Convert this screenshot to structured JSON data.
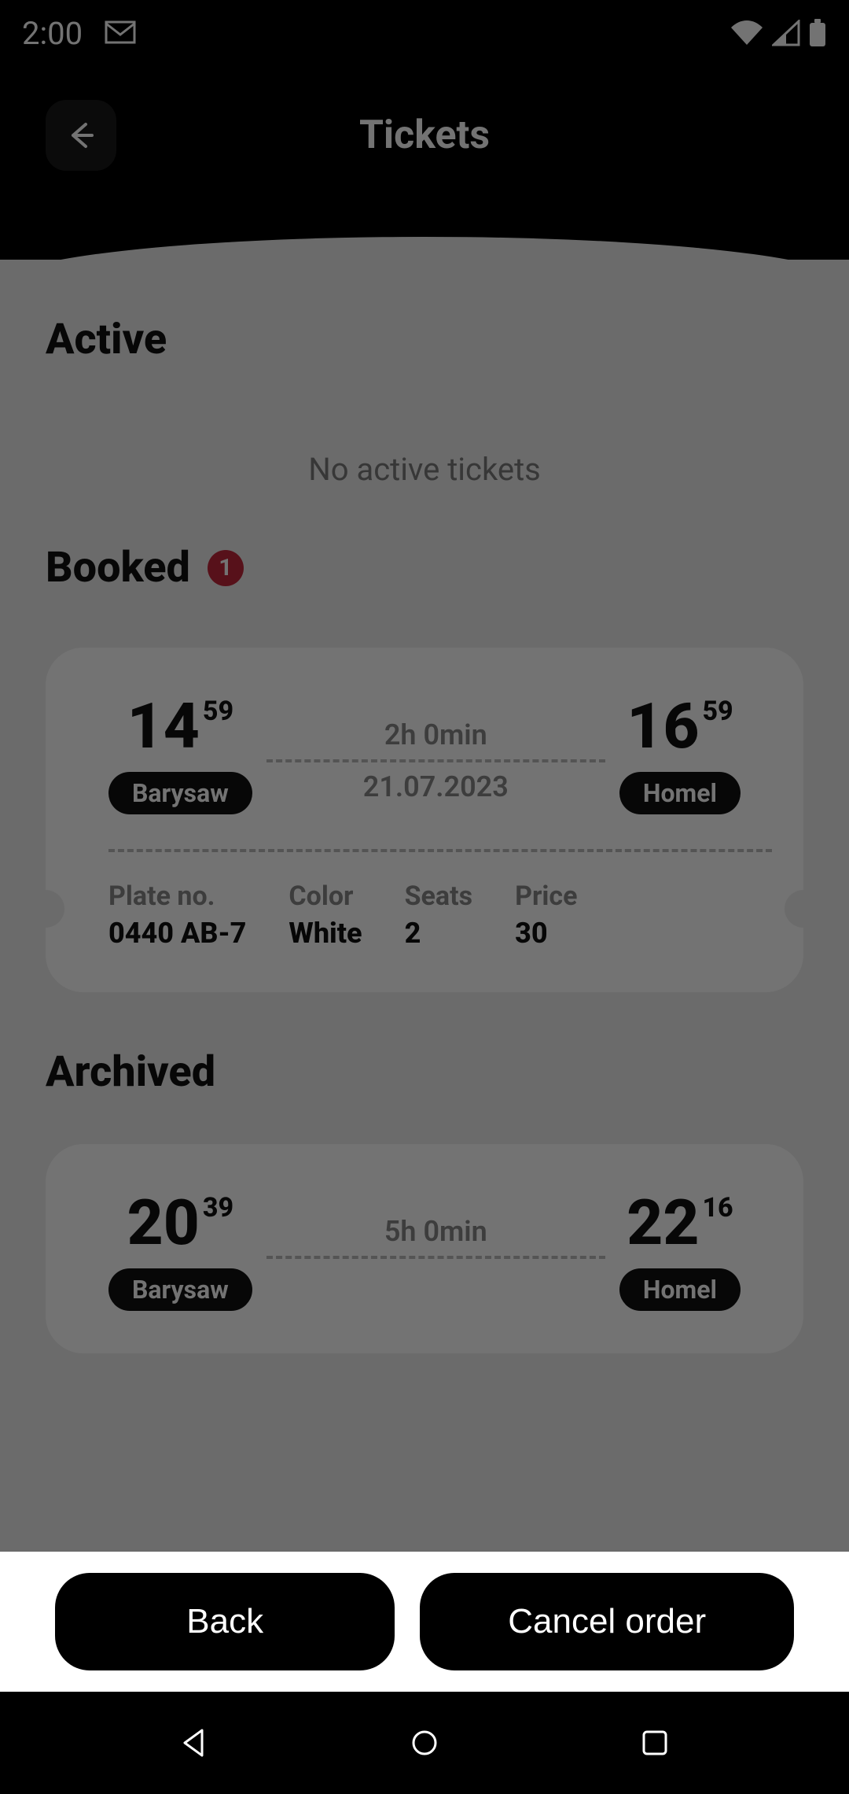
{
  "status": {
    "time": "2:00"
  },
  "header": {
    "title": "Tickets"
  },
  "sections": {
    "active": {
      "title": "Active",
      "empty_text": "No active tickets"
    },
    "booked": {
      "title": "Booked",
      "badge": "1"
    },
    "archived": {
      "title": "Archived"
    }
  },
  "booked_ticket": {
    "dep_h": "14",
    "dep_m": "59",
    "dep_city": "Barysaw",
    "arr_h": "16",
    "arr_m": "59",
    "arr_city": "Homel",
    "duration": "2h 0min",
    "date": "21.07.2023",
    "labels": {
      "plate": "Plate no.",
      "color": "Color",
      "seats": "Seats",
      "price": "Price"
    },
    "plate": "0440 AB-7",
    "color": "White",
    "seats": "2",
    "price": "30"
  },
  "archived_ticket": {
    "dep_h": "20",
    "dep_m": "39",
    "dep_city": "Barysaw",
    "arr_h": "22",
    "arr_m": "16",
    "arr_city": "Homel",
    "duration": "5h 0min"
  },
  "sheet": {
    "back": "Back",
    "cancel": "Cancel order"
  }
}
